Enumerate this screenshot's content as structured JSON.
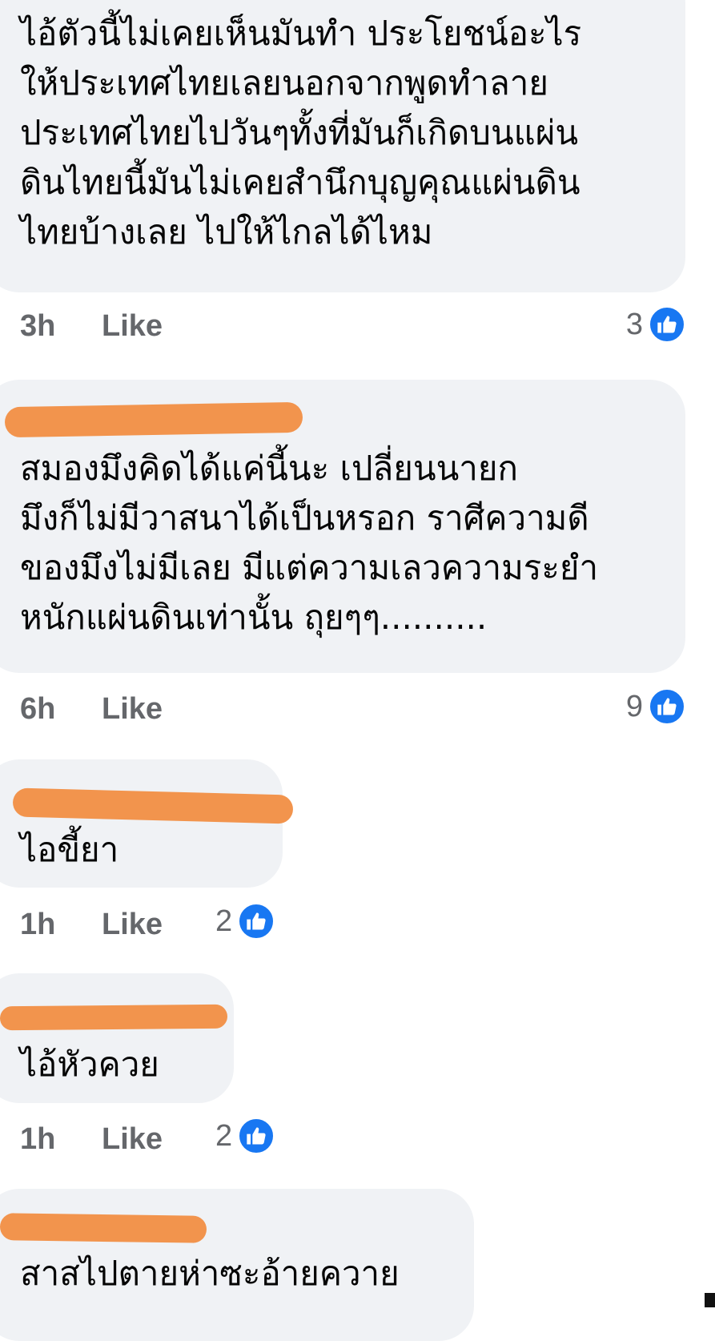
{
  "colors": {
    "bubble": "#f0f2f5",
    "redaction": "#f2944d",
    "meta_text": "#65676b",
    "like_blue": "#1877f2"
  },
  "comments": [
    {
      "text": "ไอ้ตัวนี้ไม่เคยเห็นมันทำ ประโยชน์อะไร\nให้ประเทศไทยเลยนอกจากพูดทำลาย\nประเทศไทยไปวันๆทั้งที่มันก็เกิดบนแผ่น\nดินไทยนี้มันไม่เคยสำนึกบุญคุณแผ่นดิน\nไทยบ้างเลย ไปให้ไกลได้ไหม",
      "time": "3h",
      "like_label": "Like",
      "reaction_count": "3",
      "reaction_icon": "like-icon"
    },
    {
      "text": "สมองมึงคิดได้แค่นี้นะ เปลี่ยนนายก\nมึงก็ไม่มีวาสนาได้เป็นหรอก ราศีความดี\nของมึงไม่มีเลย มีแต่ความเลวความระยำ\nหนักแผ่นดินเท่านั้น ถุยๆๆ..........",
      "time": "6h",
      "like_label": "Like",
      "reaction_count": "9",
      "reaction_icon": "like-icon"
    },
    {
      "text": "ไอขี้ยา",
      "time": "1h",
      "like_label": "Like",
      "reaction_count": "2",
      "reaction_icon": "like-icon"
    },
    {
      "text": "ไอ้หัวควย",
      "time": "1h",
      "like_label": "Like",
      "reaction_count": "2",
      "reaction_icon": "like-icon"
    },
    {
      "text": "สาสไปตายห่าซะอ้ายควาย"
    }
  ]
}
